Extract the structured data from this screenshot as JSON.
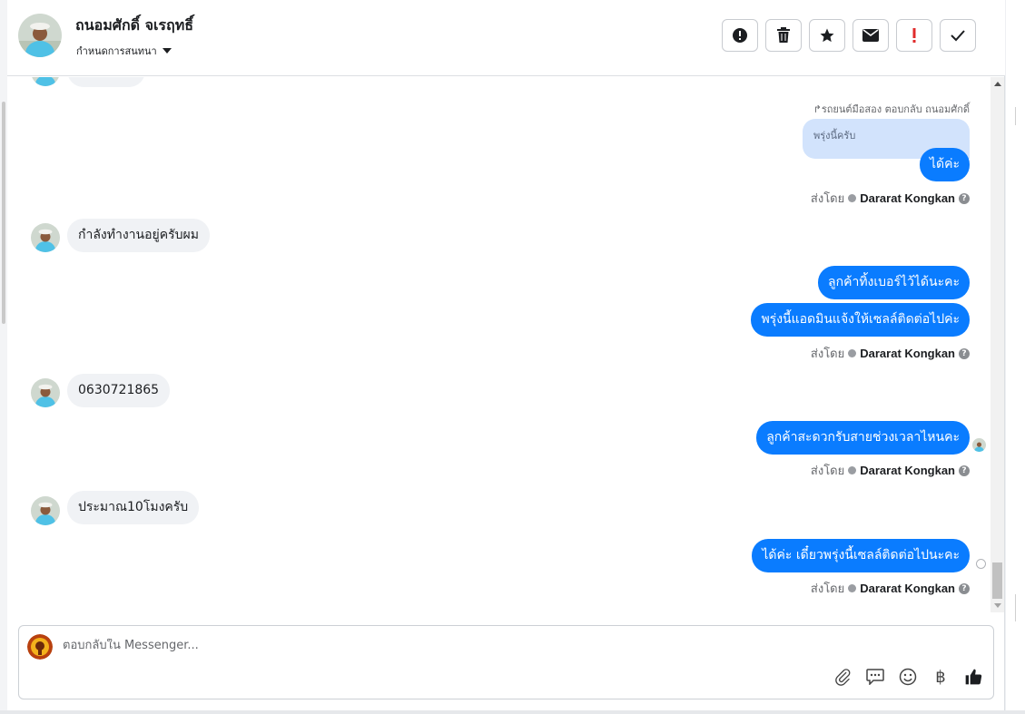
{
  "header": {
    "contact_name": "ถนอมศักดิ์ จเรฤทธิ์",
    "assign_label": "กำหนดการสนทนา",
    "actions": [
      "mark-spam",
      "delete",
      "star",
      "mark-unread",
      "follow-up",
      "done"
    ]
  },
  "thread": {
    "partial_top_text": "…",
    "reply_context": "↱รถยนต์มือสอง ตอบกลับ ถนอมศักดิ์",
    "reply_quote": "พรุ่งนี้ครับ",
    "messages": [
      {
        "dir": "out",
        "text": "ได้ค่ะ"
      },
      {
        "dir": "in",
        "text": "กำลังทำงานอยู่ครับผม"
      },
      {
        "dir": "out",
        "text": "ลูกค้าทิ้งเบอร์ไว้ได้นะคะ"
      },
      {
        "dir": "out",
        "text": "พรุ่งนี้แอดมินแจ้งให้เซลล์ติดต่อไปค่ะ"
      },
      {
        "dir": "in",
        "text": "0630721865"
      },
      {
        "dir": "out",
        "text": "ลูกค้าสะดวกรับสายช่วงเวลาไหนคะ"
      },
      {
        "dir": "in",
        "text": "ประมาณ10โมงครับ"
      },
      {
        "dir": "out",
        "text": "ได้ค่ะ เดี๋ยวพรุ่งนี้เซลล์ติดต่อไปนะคะ"
      }
    ],
    "sent_by_prefix": "ส่งโดย",
    "sent_by_name": "Dararat Kongkan"
  },
  "composer": {
    "placeholder": "ตอบกลับใน Messenger...",
    "tools": [
      "paperclip-icon",
      "saved-reply-icon",
      "emoji-icon",
      "baht-icon",
      "thumbs-up-icon"
    ],
    "baht_glyph": "฿"
  },
  "colors": {
    "outgoing_bubble": "#0a7cff",
    "incoming_bubble": "#f0f2f5",
    "reply_quote_bg": "#d2e3fc"
  }
}
